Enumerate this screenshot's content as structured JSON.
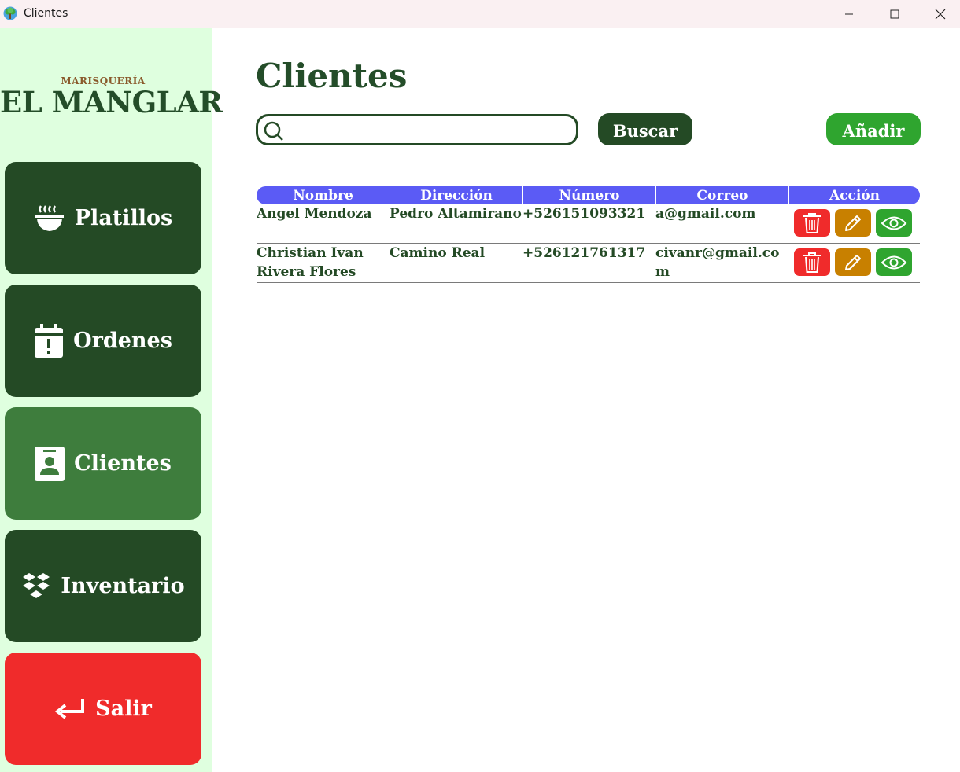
{
  "window": {
    "title": "Clientes"
  },
  "sidebar": {
    "logo_small": "MARISQUERÍA",
    "logo_big": "EL MANGLAR",
    "items": [
      {
        "label": "Platillos",
        "icon": "bowl-icon"
      },
      {
        "label": "Ordenes",
        "icon": "calendar-alert-icon"
      },
      {
        "label": "Clientes",
        "icon": "contact-card-icon",
        "active": true
      },
      {
        "label": "Inventario",
        "icon": "boxes-icon"
      },
      {
        "label": "Salir",
        "icon": "return-arrow-icon"
      }
    ]
  },
  "main": {
    "title": "Clientes",
    "search": {
      "value": "",
      "placeholder": ""
    },
    "search_button": "Buscar",
    "add_button": "Añadir"
  },
  "table": {
    "columns": [
      "Nombre",
      "Dirección",
      "Número",
      "Correo",
      "Acción"
    ],
    "rows": [
      {
        "nombre": "Angel Mendoza",
        "direccion": "Pedro Altamirano",
        "numero": "+526151093321",
        "correo": "a@gmail.com"
      },
      {
        "nombre": "Christian Ivan Rivera Flores",
        "direccion": "Camino Real",
        "numero": "+526121761317",
        "correo": "civanr@gmail.com"
      }
    ]
  },
  "colors": {
    "sidebar_bg": "#dfffdf",
    "nav_dark": "#244a25",
    "nav_active": "#3e7d3d",
    "exit_red": "#f02b2b",
    "header_blue": "#5b5bf5",
    "add_green": "#2fa52f",
    "edit_orange": "#c88000"
  }
}
